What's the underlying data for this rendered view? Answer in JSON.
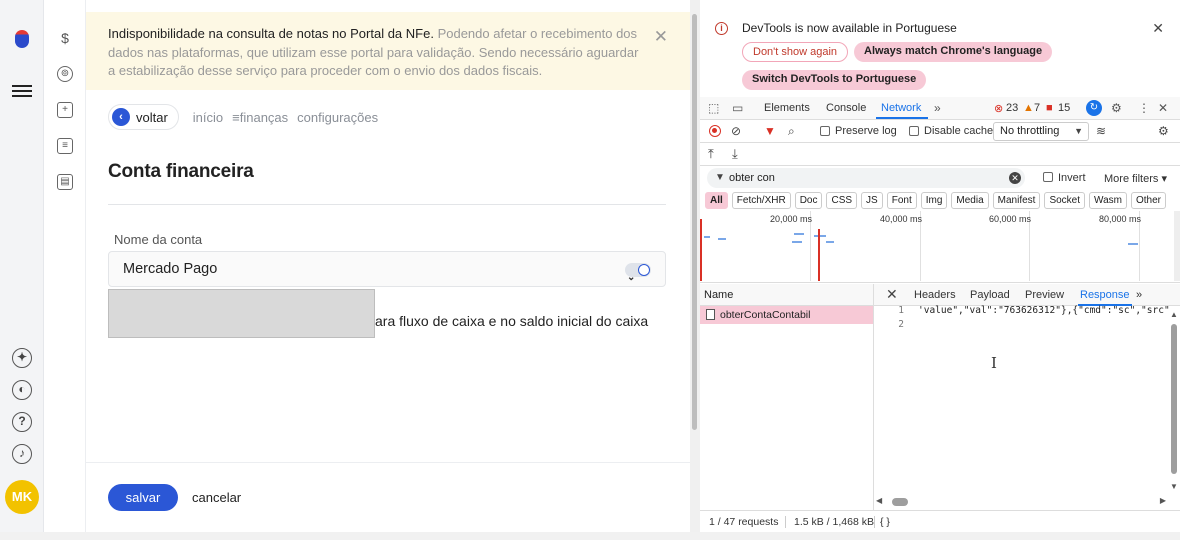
{
  "banner": {
    "bold": "Indisponibilidade na consulta de notas no Portal da NFe.",
    "text": " Podendo afetar o recebimento dos dados nas plataformas, que utilizam esse portal para validação. Sendo necessário aguardar a estabilização desse serviço para proceder com o envio dos dados fiscais."
  },
  "nav": {
    "back": "voltar",
    "crumbs": [
      "início",
      "≡finanças",
      "configurações"
    ]
  },
  "page": {
    "title": "Conta financeira",
    "account_label": "Nome da conta",
    "account_value": "Mercado Pago",
    "partial_text": "ara fluxo de caixa e no saldo inicial do caixa",
    "save": "salvar",
    "cancel": "cancelar"
  },
  "user": {
    "initials": "MK"
  },
  "devtools": {
    "notice": "DevTools is now available in Portuguese",
    "btn_dont_show": "Don't show again",
    "btn_match": "Always match Chrome's language",
    "btn_switch": "Switch DevTools to Portuguese",
    "tabs": [
      "Elements",
      "Console",
      "Network"
    ],
    "errors": "23",
    "warnings": "7",
    "issues": "15",
    "preserve_log": "Preserve log",
    "disable_cache": "Disable cache",
    "throttling": "No throttling",
    "filter_value": "obter con",
    "invert": "Invert",
    "more_filters": "More filters",
    "types": [
      "All",
      "Fetch/XHR",
      "Doc",
      "CSS",
      "JS",
      "Font",
      "Img",
      "Media",
      "Manifest",
      "Socket",
      "Wasm",
      "Other"
    ],
    "timeline_labels": [
      "20,000 ms",
      "40,000 ms",
      "60,000 ms",
      "80,000 ms"
    ],
    "name_col": "Name",
    "panel_tabs": [
      "Headers",
      "Payload",
      "Preview",
      "Response"
    ],
    "request_name": "obterContaContabil",
    "code_lines": [
      {
        "n": "1",
        "text": "'value\",\"val\":\"763626312\"},{\"cmd\":\"sc\",\"src\""
      },
      {
        "n": "2",
        "text": ""
      }
    ],
    "status_requests": "1 / 47 requests",
    "status_size": "1.5 kB / 1,468 kB"
  },
  "colors": {
    "primary": "#2b57d6",
    "active_pink": "#f7c9d6",
    "banner_bg": "#fdf8e4"
  }
}
